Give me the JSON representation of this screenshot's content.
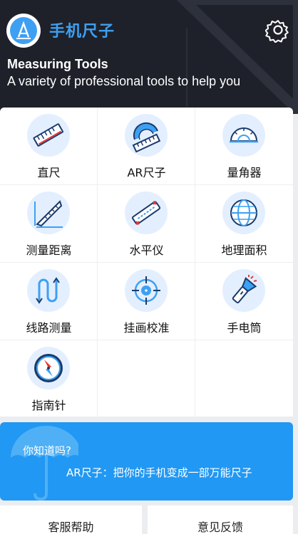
{
  "header": {
    "app_title": "手机尺子",
    "tagline_title": "Measuring Tools",
    "tagline_subtitle": "A variety of professional tools to help you"
  },
  "tools": [
    {
      "label": "直尺",
      "icon": "ruler-icon"
    },
    {
      "label": "AR尺子",
      "icon": "ar-ruler-icon"
    },
    {
      "label": "量角器",
      "icon": "protractor-icon"
    },
    {
      "label": "测量距离",
      "icon": "distance-measure-icon"
    },
    {
      "label": "水平仪",
      "icon": "level-icon"
    },
    {
      "label": "地理面积",
      "icon": "globe-icon"
    },
    {
      "label": "线路测量",
      "icon": "route-measure-icon"
    },
    {
      "label": "挂画校准",
      "icon": "crosshair-icon"
    },
    {
      "label": "手电筒",
      "icon": "flashlight-icon"
    },
    {
      "label": "指南针",
      "icon": "compass-icon"
    }
  ],
  "banner": {
    "question": "你知道吗?",
    "tip": "AR尺子：把你的手机变成一部万能尺子"
  },
  "footer": {
    "help_label": "客服帮助",
    "feedback_label": "意见反馈"
  },
  "colors": {
    "header_bg": "#1e2129",
    "accent": "#3da0f2",
    "banner_bg": "#2198f3",
    "icon_circle": "#e3efff"
  }
}
